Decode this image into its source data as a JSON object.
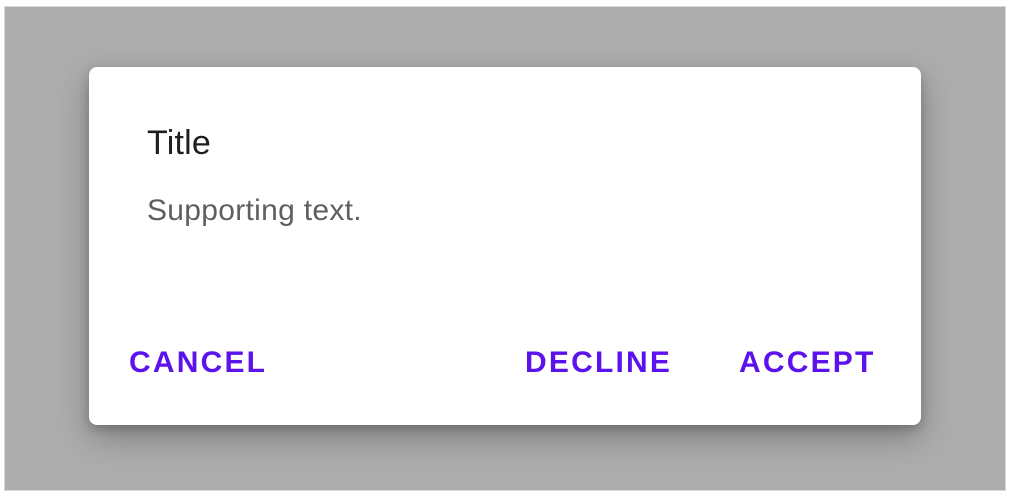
{
  "dialog": {
    "title": "Title",
    "supporting_text": "Supporting text.",
    "actions": {
      "cancel": "CANCEL",
      "decline": "DECLINE",
      "accept": "ACCEPT"
    }
  },
  "colors": {
    "scrim": "#adadad",
    "surface": "#ffffff",
    "title": "#1f1f1f",
    "supporting_text": "#5f5f5f",
    "action": "#5b12ec"
  }
}
